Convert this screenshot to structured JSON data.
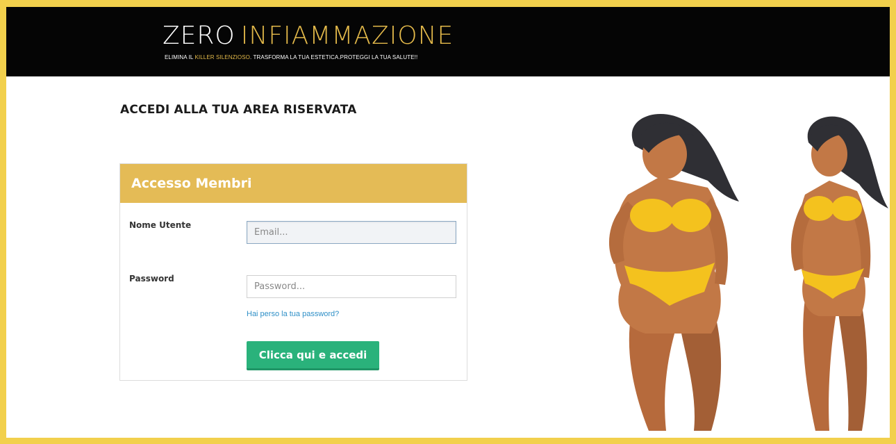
{
  "header": {
    "logo_word1": "ZERO",
    "logo_word2": "INFIAMMAZIONE",
    "tagline_part1": "ELIMINA IL ",
    "tagline_accent": "KILLER SILENZIOSO",
    "tagline_part2": ". TRASFORMA LA TUA ESTETICA.PROTEGGI LA TUA SALUTE!!"
  },
  "page": {
    "title": "ACCEDI ALLA TUA AREA RISERVATA"
  },
  "login": {
    "panel_title": "Accesso Membri",
    "username_label": "Nome Utente",
    "username_placeholder": "Email...",
    "password_label": "Password",
    "password_placeholder": "Password...",
    "lost_password_link": "Hai perso la tua password?",
    "submit_label": "Clicca qui e accedi"
  },
  "colors": {
    "border_yellow": "#f2d04c",
    "accent_gold": "#e4bb56",
    "button_green": "#2ab27b",
    "link_blue": "#2e8fc7"
  },
  "icons": [
    "woman-curvy-illustration",
    "woman-slim-illustration"
  ]
}
